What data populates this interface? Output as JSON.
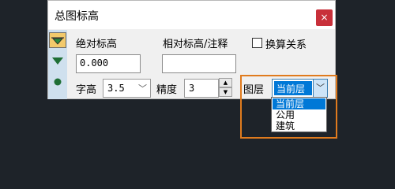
{
  "window": {
    "title": "总图标高",
    "close_glyph": "×"
  },
  "toolbar": {
    "items": [
      {
        "icon": "triangle-marker-icon"
      },
      {
        "icon": "triangle-down-icon"
      },
      {
        "icon": "dot-icon"
      }
    ]
  },
  "absolute_elevation": {
    "label": "绝对标高",
    "value": "0.000"
  },
  "relative_elevation": {
    "label": "相对标高/注释",
    "value": ""
  },
  "convert": {
    "label": "换算关系",
    "checked": false
  },
  "font_height": {
    "label": "字高",
    "value": "3.5"
  },
  "precision": {
    "label": "精度",
    "value": "3"
  },
  "layer": {
    "label": "图层",
    "selected": "当前层",
    "options": [
      "当前层",
      "公用",
      "建筑"
    ]
  },
  "colors": {
    "accent": "#0078d7",
    "highlight": "#e07b1e",
    "close": "#c8303a"
  }
}
